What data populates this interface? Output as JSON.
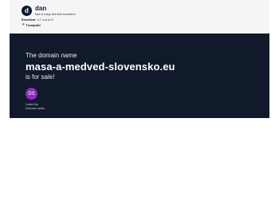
{
  "header": {
    "brand_logo_letter": "d",
    "brand_name": "dan",
    "tagline": "fast & easy domain transfers",
    "rating_label": "Excellent",
    "rating_value": "4.7 out of 5",
    "trustpilot_label": "Trustpilot",
    "trustpilot_icon": "star-icon"
  },
  "hero": {
    "intro": "The domain name",
    "domain": "masa-a-medved-slovensko.eu",
    "for_sale": "is for sale!",
    "seller": {
      "initials": "DS",
      "listed_by": "Listed by",
      "name": "Domain seller"
    }
  },
  "colors": {
    "hero_bg": "#111a2b",
    "avatar_bg": "#8a2dc0",
    "trustpilot_green": "#00b67a",
    "header_bg": "#f5f5f7"
  }
}
